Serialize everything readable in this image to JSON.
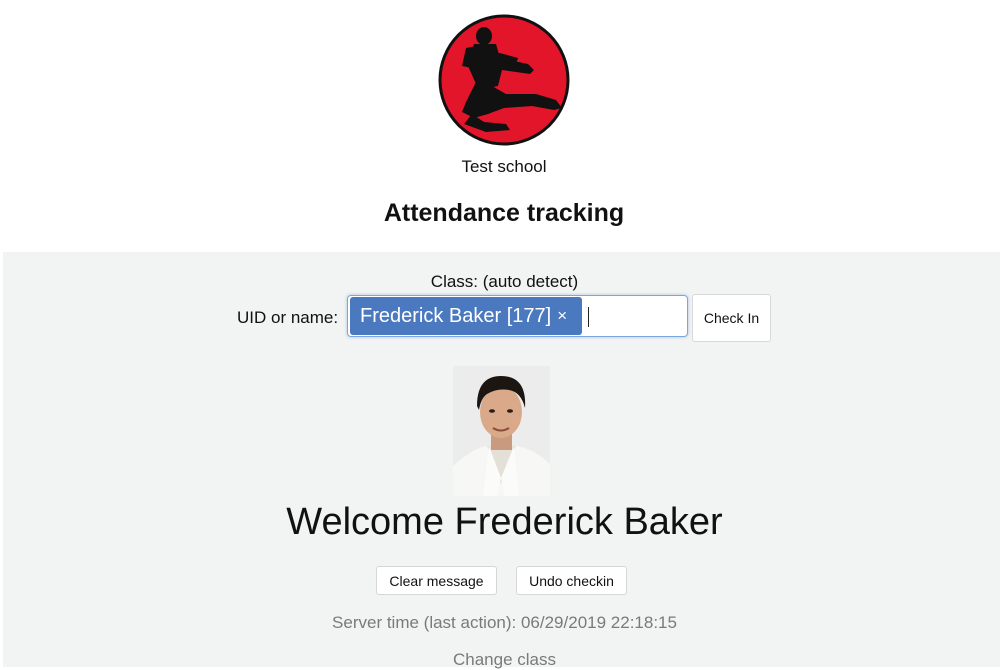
{
  "header": {
    "logo_icon": "karate-flying-kick-logo",
    "logo_color": "#e3152b",
    "school_name": "Test school",
    "page_title": "Attendance tracking"
  },
  "checkin": {
    "class_line": "Class: (auto detect)",
    "uid_label": "UID or name:",
    "selected_token": "Frederick Baker [177]",
    "token_remove": "×",
    "token_color": "#4b79bf",
    "checkin_label": "Check In"
  },
  "result": {
    "photo_icon": "student-photo",
    "welcome": "Welcome Frederick Baker",
    "clear_label": "Clear message",
    "undo_label": "Undo checkin",
    "server_time": "Server time (last action): 06/29/2019 22:18:15",
    "change_class": "Change class"
  }
}
